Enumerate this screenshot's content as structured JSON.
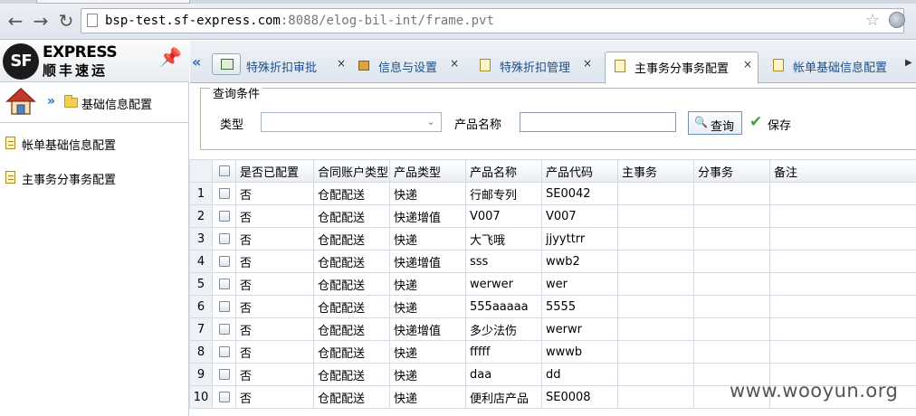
{
  "browser": {
    "url_host": "bsp-test.sf-express.com",
    "url_rest": ":8088/elog-bil-int/frame.pvt",
    "back_icon": "back-arrow-icon",
    "forward_icon": "forward-arrow-icon",
    "reload_icon": "reload-icon"
  },
  "brand": {
    "logo_mark": "SF",
    "name_en": "EXPRESS",
    "name_cn": "顺丰速运"
  },
  "breadcrumb": {
    "label": "基础信息配置"
  },
  "sidebar": {
    "items": [
      {
        "label": "帐单基础信息配置"
      },
      {
        "label": "主事务分事务配置"
      }
    ]
  },
  "tabs": [
    {
      "label": "特殊折扣审批",
      "close": "×",
      "active": false
    },
    {
      "label": "信息与设置",
      "close": "×",
      "active": false
    },
    {
      "label": "特殊折扣管理",
      "close": "×",
      "active": false
    },
    {
      "label": "主事务分事务配置",
      "close": "×",
      "active": true
    },
    {
      "label": "帐单基础信息配置",
      "close": "",
      "active": false
    }
  ],
  "query": {
    "legend": "查询条件",
    "type_label": "类型",
    "type_value": "",
    "product_name_label": "产品名称",
    "product_name_value": "",
    "query_button": "查询",
    "save_button": "保存"
  },
  "grid": {
    "columns": [
      "是否已配置",
      "合同账户类型",
      "产品类型",
      "产品名称",
      "产品代码",
      "主事务",
      "分事务",
      "备注"
    ],
    "rows": [
      {
        "num": "1",
        "configured": "否",
        "account_type": "仓配配送",
        "product_type": "快递",
        "product_name": "行邮专列",
        "product_code": "SE0042",
        "main": "",
        "sub": "",
        "remark": ""
      },
      {
        "num": "2",
        "configured": "否",
        "account_type": "仓配配送",
        "product_type": "快递增值",
        "product_name": "V007",
        "product_code": "V007",
        "main": "",
        "sub": "",
        "remark": ""
      },
      {
        "num": "3",
        "configured": "否",
        "account_type": "仓配配送",
        "product_type": "快递",
        "product_name": "大飞哦",
        "product_code": "jjyyttrr",
        "main": "",
        "sub": "",
        "remark": ""
      },
      {
        "num": "4",
        "configured": "否",
        "account_type": "仓配配送",
        "product_type": "快递增值",
        "product_name": "sss",
        "product_code": "wwb2",
        "main": "",
        "sub": "",
        "remark": ""
      },
      {
        "num": "5",
        "configured": "否",
        "account_type": "仓配配送",
        "product_type": "快递",
        "product_name": "werwer",
        "product_code": "wer",
        "main": "",
        "sub": "",
        "remark": ""
      },
      {
        "num": "6",
        "configured": "否",
        "account_type": "仓配配送",
        "product_type": "快递",
        "product_name": "555aaaaa",
        "product_code": "5555",
        "main": "",
        "sub": "",
        "remark": ""
      },
      {
        "num": "7",
        "configured": "否",
        "account_type": "仓配配送",
        "product_type": "快递增值",
        "product_name": "多少法伤",
        "product_code": "werwr",
        "main": "",
        "sub": "",
        "remark": ""
      },
      {
        "num": "8",
        "configured": "否",
        "account_type": "仓配配送",
        "product_type": "快递",
        "product_name": "fffff",
        "product_code": "wwwb",
        "main": "",
        "sub": "",
        "remark": ""
      },
      {
        "num": "9",
        "configured": "否",
        "account_type": "仓配配送",
        "product_type": "快递",
        "product_name": "daa",
        "product_code": "dd",
        "main": "",
        "sub": "",
        "remark": ""
      },
      {
        "num": "10",
        "configured": "否",
        "account_type": "仓配配送",
        "product_type": "快递",
        "product_name": "便利店产品",
        "product_code": "SE0008",
        "main": "",
        "sub": "",
        "remark": ""
      }
    ]
  },
  "watermark": "www.wooyun.org"
}
